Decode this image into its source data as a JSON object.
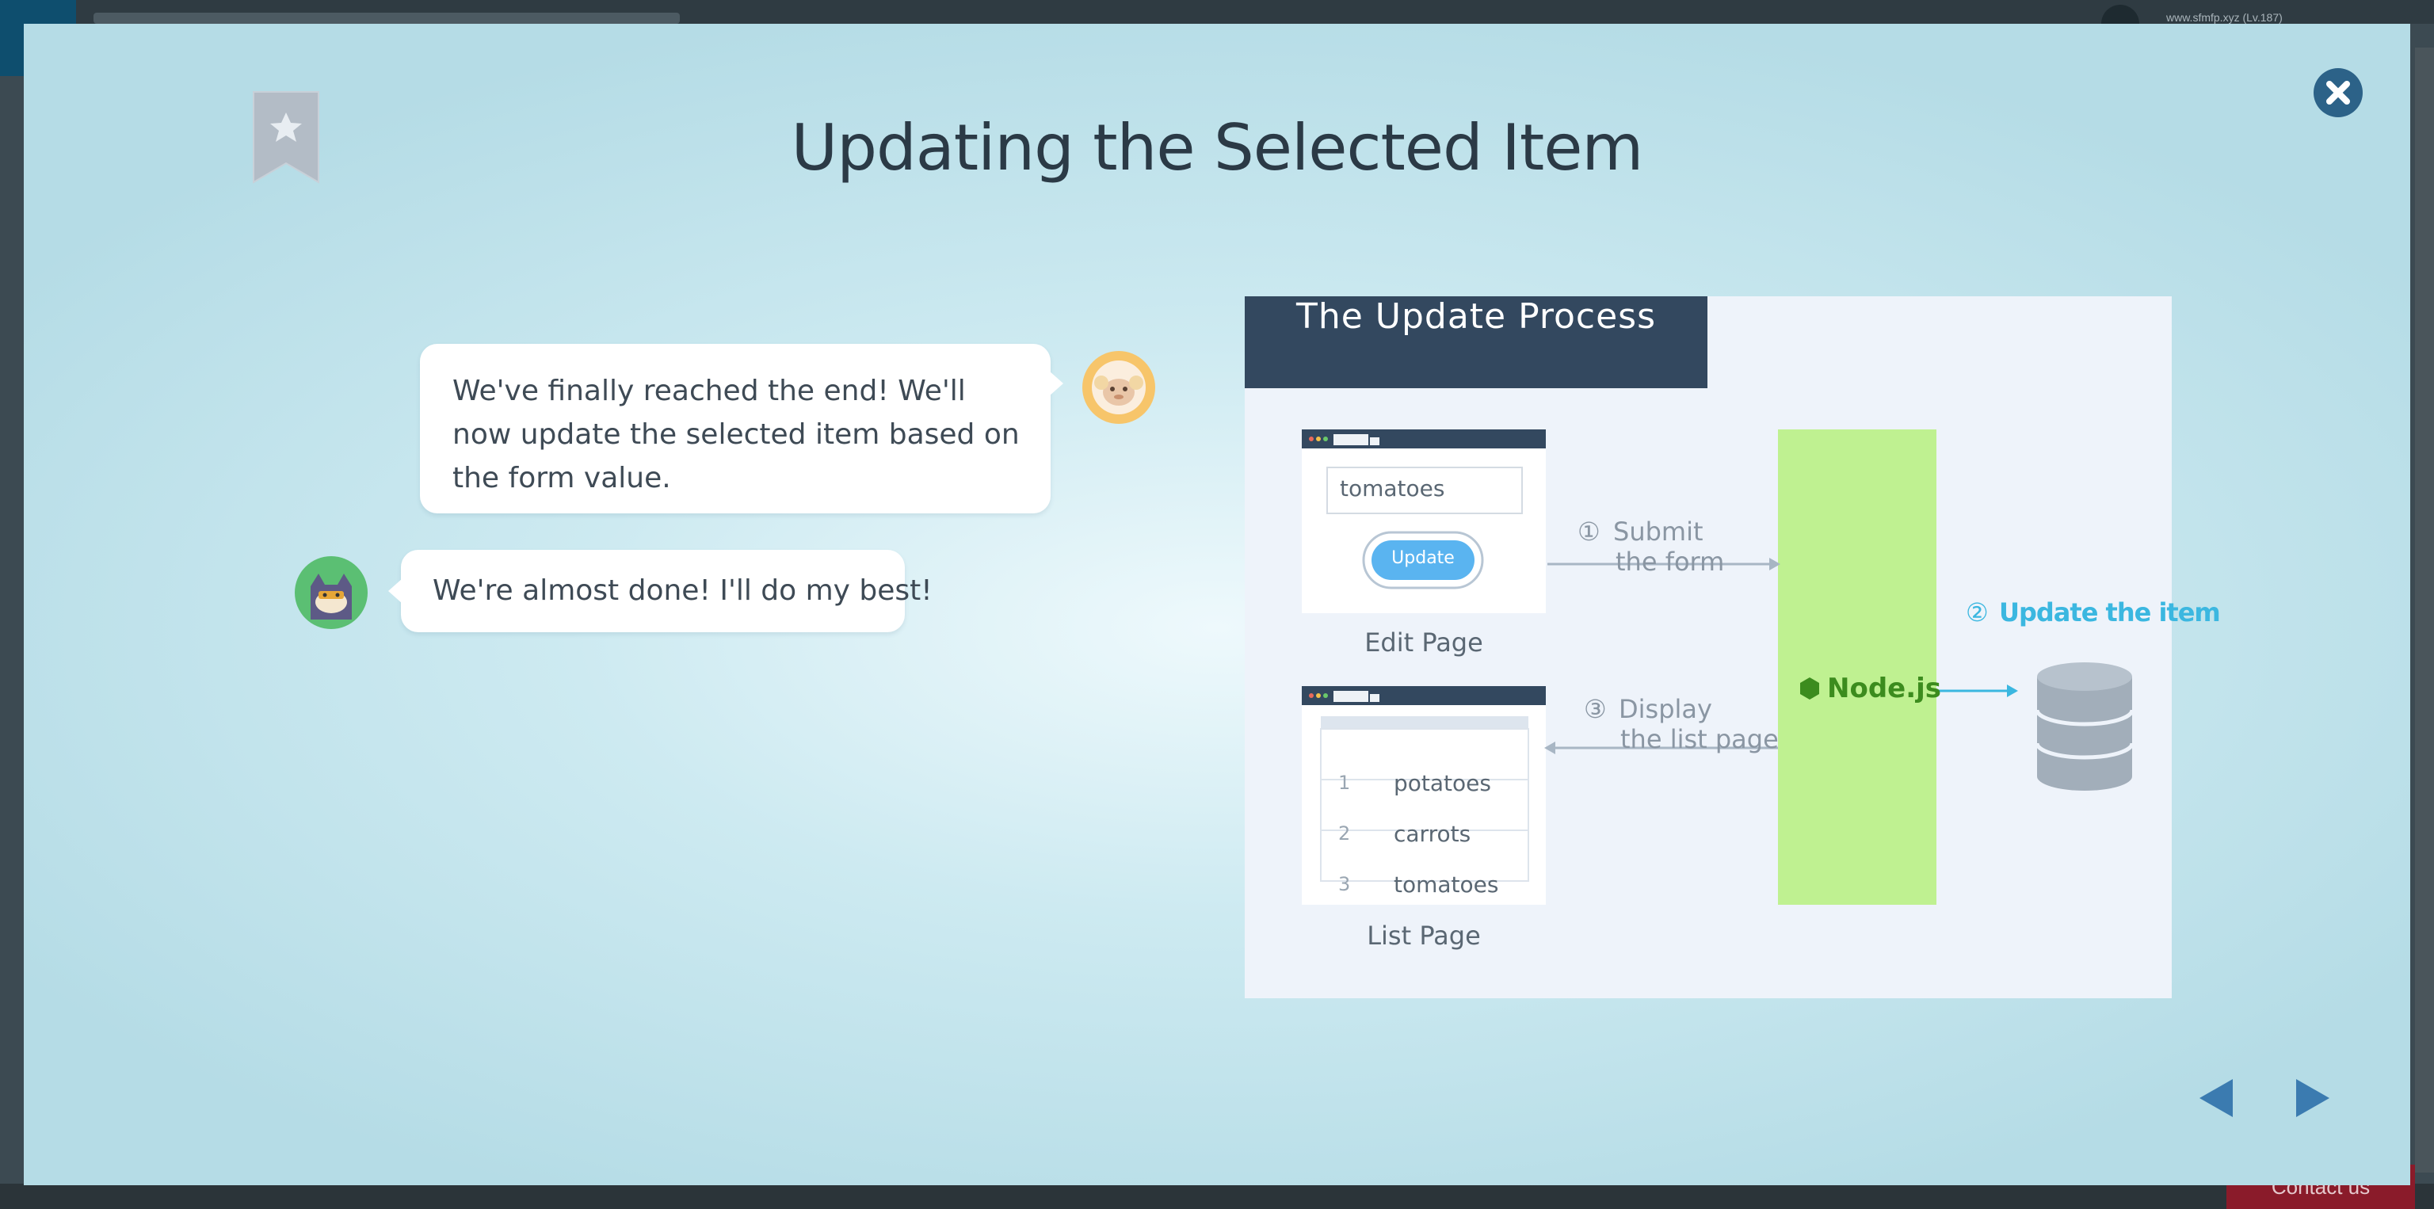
{
  "background_app": {
    "user_text": "www.sfmfp.xyz (Lv.187)",
    "contact_label": "Contact us"
  },
  "modal": {
    "title": "Updating the Selected Item",
    "bookmark_icon": "bookmark-star-icon",
    "close_icon": "close-icon",
    "messages": [
      {
        "speaker": "sheep",
        "text": "We've finally reached the end! We'll now update the selected item based on the form value."
      },
      {
        "speaker": "cat",
        "text": "We're almost done! I'll do my best!"
      }
    ],
    "figure": {
      "header": "The Update Process",
      "edit_page": {
        "input_value": "tomatoes",
        "button_label": "Update",
        "caption": "Edit Page"
      },
      "list_page": {
        "items": [
          {
            "num": "1",
            "label": "potatoes"
          },
          {
            "num": "2",
            "label": "carrots"
          },
          {
            "num": "3",
            "label": "tomatoes"
          }
        ],
        "caption": "List Page"
      },
      "step1": {
        "marker": "①",
        "line1": "Submit",
        "line2": "the form"
      },
      "step2": {
        "marker": "②",
        "label": "Update the item"
      },
      "step3": {
        "marker": "③",
        "line1": "Display",
        "line2": "the list page"
      },
      "server_label": "Node.js",
      "colors": {
        "server": "#bff191",
        "server_text": "#3c8c1e",
        "accent": "#3bb7e0",
        "header": "#33485f"
      }
    },
    "nav": {
      "prev_icon": "previous-arrow-icon",
      "next_icon": "next-arrow-icon"
    }
  }
}
